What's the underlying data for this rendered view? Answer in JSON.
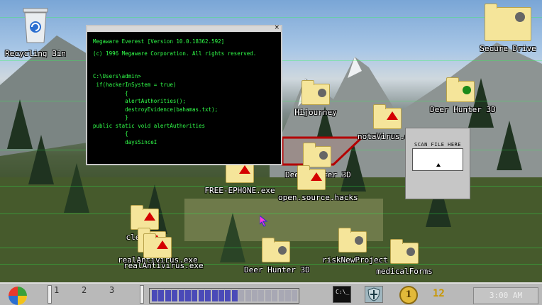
{
  "desktop": {
    "icons": {
      "recycling_bin": "Recycling Bin",
      "secure_drive": "Secure Drive",
      "hijourney": "Hijourney",
      "deer_hunter_top": "Deer Hunter 3D",
      "nota_virus": "notaVirus.exe",
      "free_ephone": "FREE-EPHONE.exe",
      "deer_hunter_mid": "Deer Hunter 3D",
      "open_source_hacks": "open.source.hacks",
      "clerks_hd": "clerksHD",
      "real_antivirus_1": "realAntivirus.exe",
      "real_antivirus_2": "realAntivirus.exe",
      "deer_hunter_bottom": "Deer Hunter 3D",
      "risk_new_project": "riskNewProject",
      "medical_forms": "medicalForms"
    }
  },
  "terminal": {
    "lines": [
      "Megaware Everest [Version 10.0.18362.592]",
      "(c) 1996 Megaware Corporation. All rights reserved.",
      "",
      "C:\\Users\\admin>",
      " if(hackerInSystem = true)",
      "          {",
      "          alertAuthorities();",
      "          destroyEvidence(bahamas.txt);",
      "          }",
      "public static void alertAuthorities",
      "          {",
      "          daysSinceI"
    ],
    "close": "×"
  },
  "scan_widget": {
    "title": "SCAN FILE HERE"
  },
  "taskbar": {
    "workspaces": [
      "1",
      "2",
      "3"
    ],
    "progress_filled": 13,
    "progress_total": 22,
    "terminal_button": "C:\\_",
    "coin": "1",
    "score": "12",
    "clock": "3:00 AM"
  },
  "colors": {
    "terminal_text": "#31ff4a",
    "progress_fill": "#4a4ab8",
    "folder": "#f5e59a",
    "warning": "#d40000"
  }
}
